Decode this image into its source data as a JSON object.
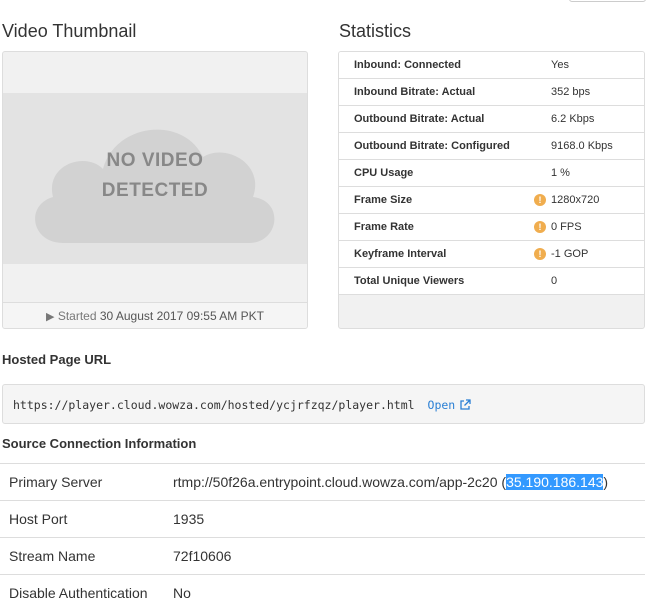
{
  "thumbnail": {
    "title": "Video Thumbnail",
    "placeholder_line1": "NO VIDEO",
    "placeholder_line2": "DETECTED",
    "started_prefix": "Started",
    "started_datetime": "30 August 2017 09:55 AM PKT"
  },
  "statistics": {
    "title": "Statistics",
    "rows": [
      {
        "label": "Inbound: Connected",
        "value": "Yes",
        "warning": false
      },
      {
        "label": "Inbound Bitrate: Actual",
        "value": "352 bps",
        "warning": false
      },
      {
        "label": "Outbound Bitrate: Actual",
        "value": "6.2 Kbps",
        "warning": false
      },
      {
        "label": "Outbound Bitrate: Configured",
        "value": "9168.0 Kbps",
        "warning": false
      },
      {
        "label": "CPU Usage",
        "value": "1 %",
        "warning": false
      },
      {
        "label": "Frame Size",
        "value": "1280x720",
        "warning": true
      },
      {
        "label": "Frame Rate",
        "value": "0 FPS",
        "warning": true
      },
      {
        "label": "Keyframe Interval",
        "value": "-1 GOP",
        "warning": true
      },
      {
        "label": "Total Unique Viewers",
        "value": "0",
        "warning": false
      }
    ]
  },
  "hosted_page": {
    "title": "Hosted Page URL",
    "url": "https://player.cloud.wowza.com/hosted/ycjrfzqz/player.html",
    "open_label": "Open"
  },
  "source_connection": {
    "title": "Source Connection Information",
    "primary_server_label": "Primary Server",
    "primary_server_url": "rtmp://50f26a.entrypoint.cloud.wowza.com/app-2c20",
    "primary_server_ip_open": " (",
    "primary_server_ip": "35.190.186.143",
    "primary_server_ip_close": ")",
    "host_port_label": "Host Port",
    "host_port": "1935",
    "stream_name_label": "Stream Name",
    "stream_name": "72f10606",
    "disable_auth_label": "Disable Authentication",
    "disable_auth": "No"
  },
  "colors": {
    "link": "#2a7fd4",
    "warning": "#f0ad4e",
    "selection": "#3399ff"
  },
  "icons": {
    "play": "play-icon",
    "warning": "warning-icon",
    "external": "external-link-icon"
  }
}
